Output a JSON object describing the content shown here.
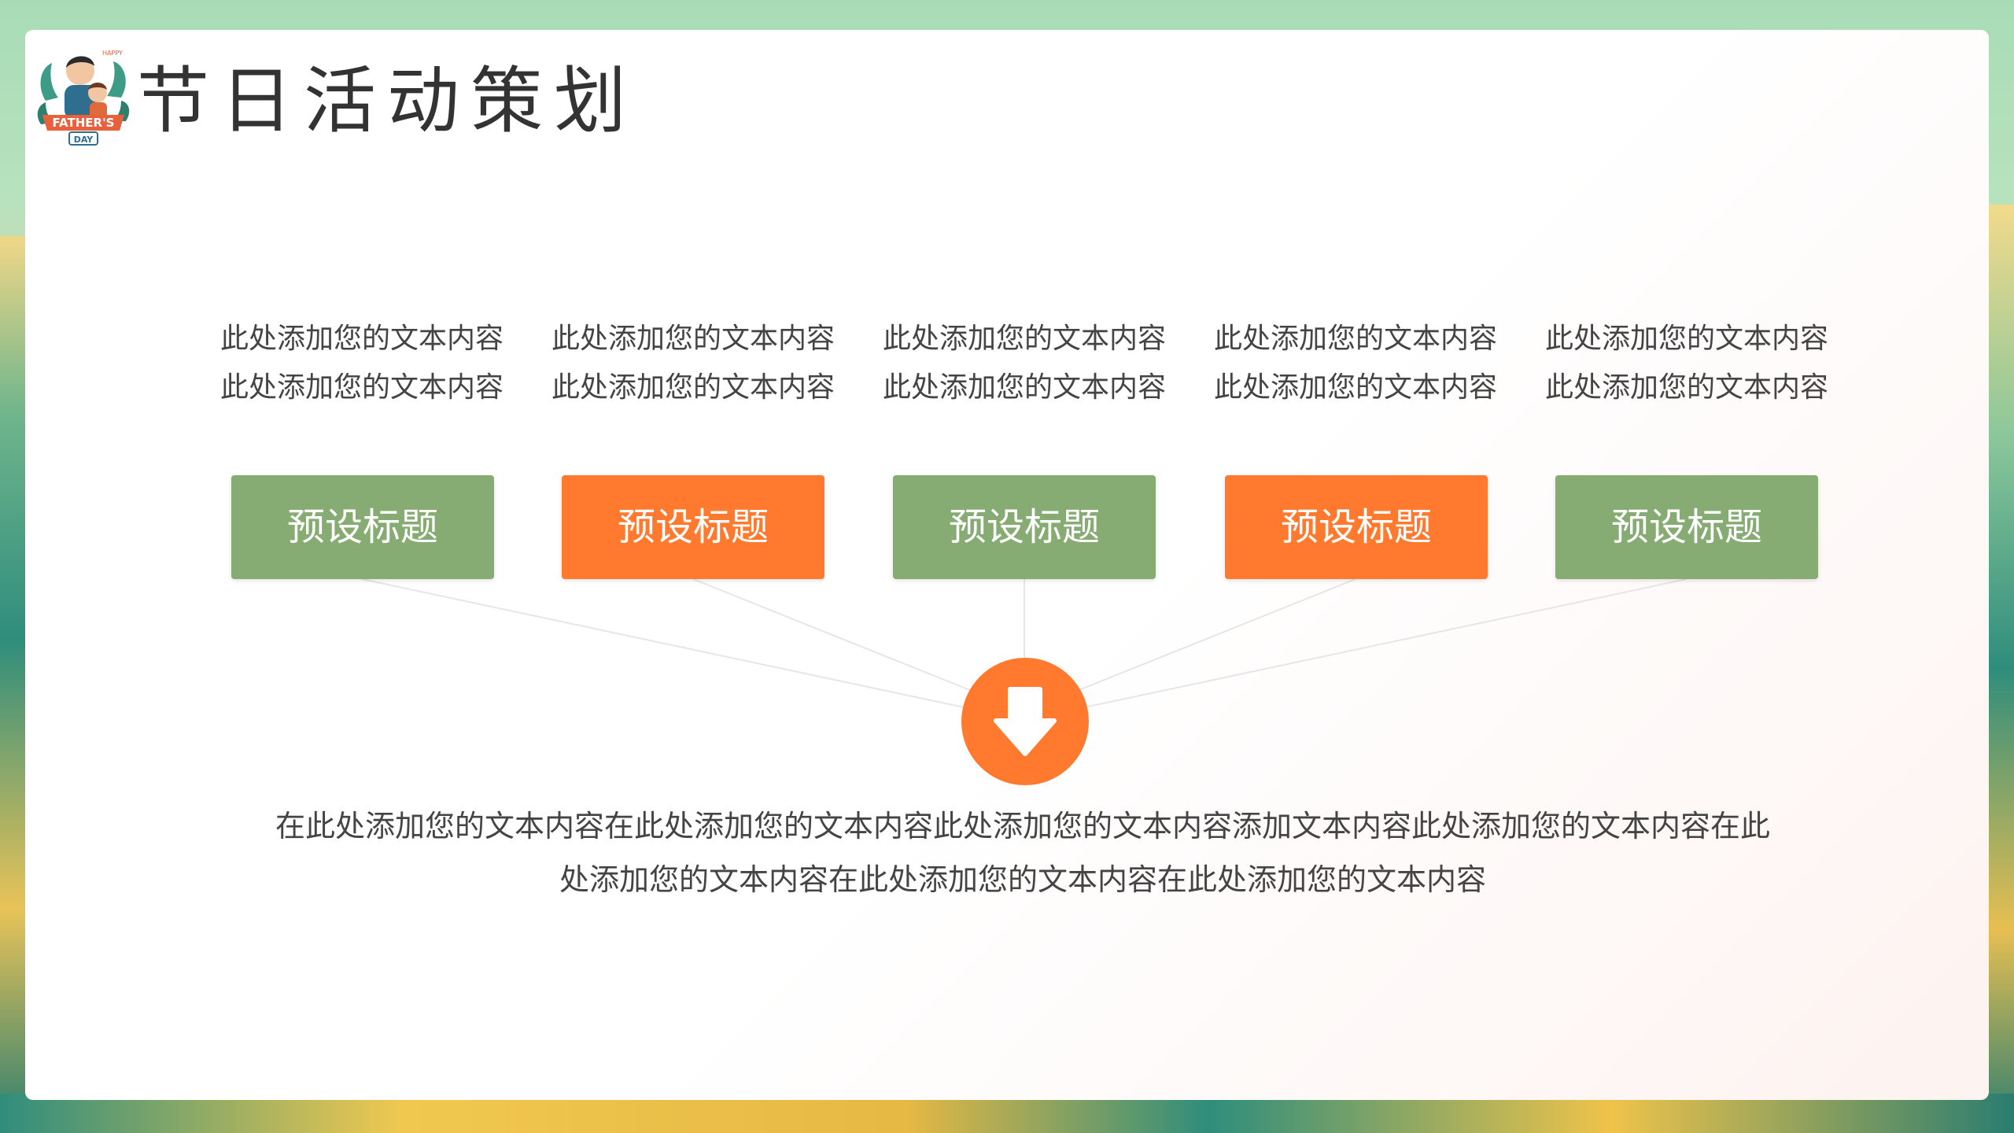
{
  "slide": {
    "title": "节日活动策划",
    "logo": {
      "icon": "fathers-day-logo-icon",
      "text_top": "HAPPY",
      "text_main": "FATHER'S",
      "text_bottom": "DAY"
    },
    "columns": [
      {
        "line1": "此处添加您的文本内容",
        "line2": "此处添加您的文本内容",
        "label": "预设标题",
        "color": "green"
      },
      {
        "line1": "此处添加您的文本内容",
        "line2": "此处添加您的文本内容",
        "label": "预设标题",
        "color": "orange"
      },
      {
        "line1": "此处添加您的文本内容",
        "line2": "此处添加您的文本内容",
        "label": "预设标题",
        "color": "green"
      },
      {
        "line1": "此处添加您的文本内容",
        "line2": "此处添加您的文本内容",
        "label": "预设标题",
        "color": "orange"
      },
      {
        "line1": "此处添加您的文本内容",
        "line2": "此处添加您的文本内容",
        "label": "预设标题",
        "color": "green"
      }
    ],
    "center_icon": "arrow-down-icon",
    "summary": {
      "line1": "在此处添加您的文本内容在此处添加您的文本内容此处添加您的文本内容添加文本内容此处添加您的文本内容在此",
      "line2": "处添加您的文本内容在此处添加您的文本内容在此处添加您的文本内容"
    }
  },
  "colors": {
    "green": "#87ac73",
    "orange": "#ff7a2e",
    "text": "#444444",
    "title": "#333333"
  }
}
